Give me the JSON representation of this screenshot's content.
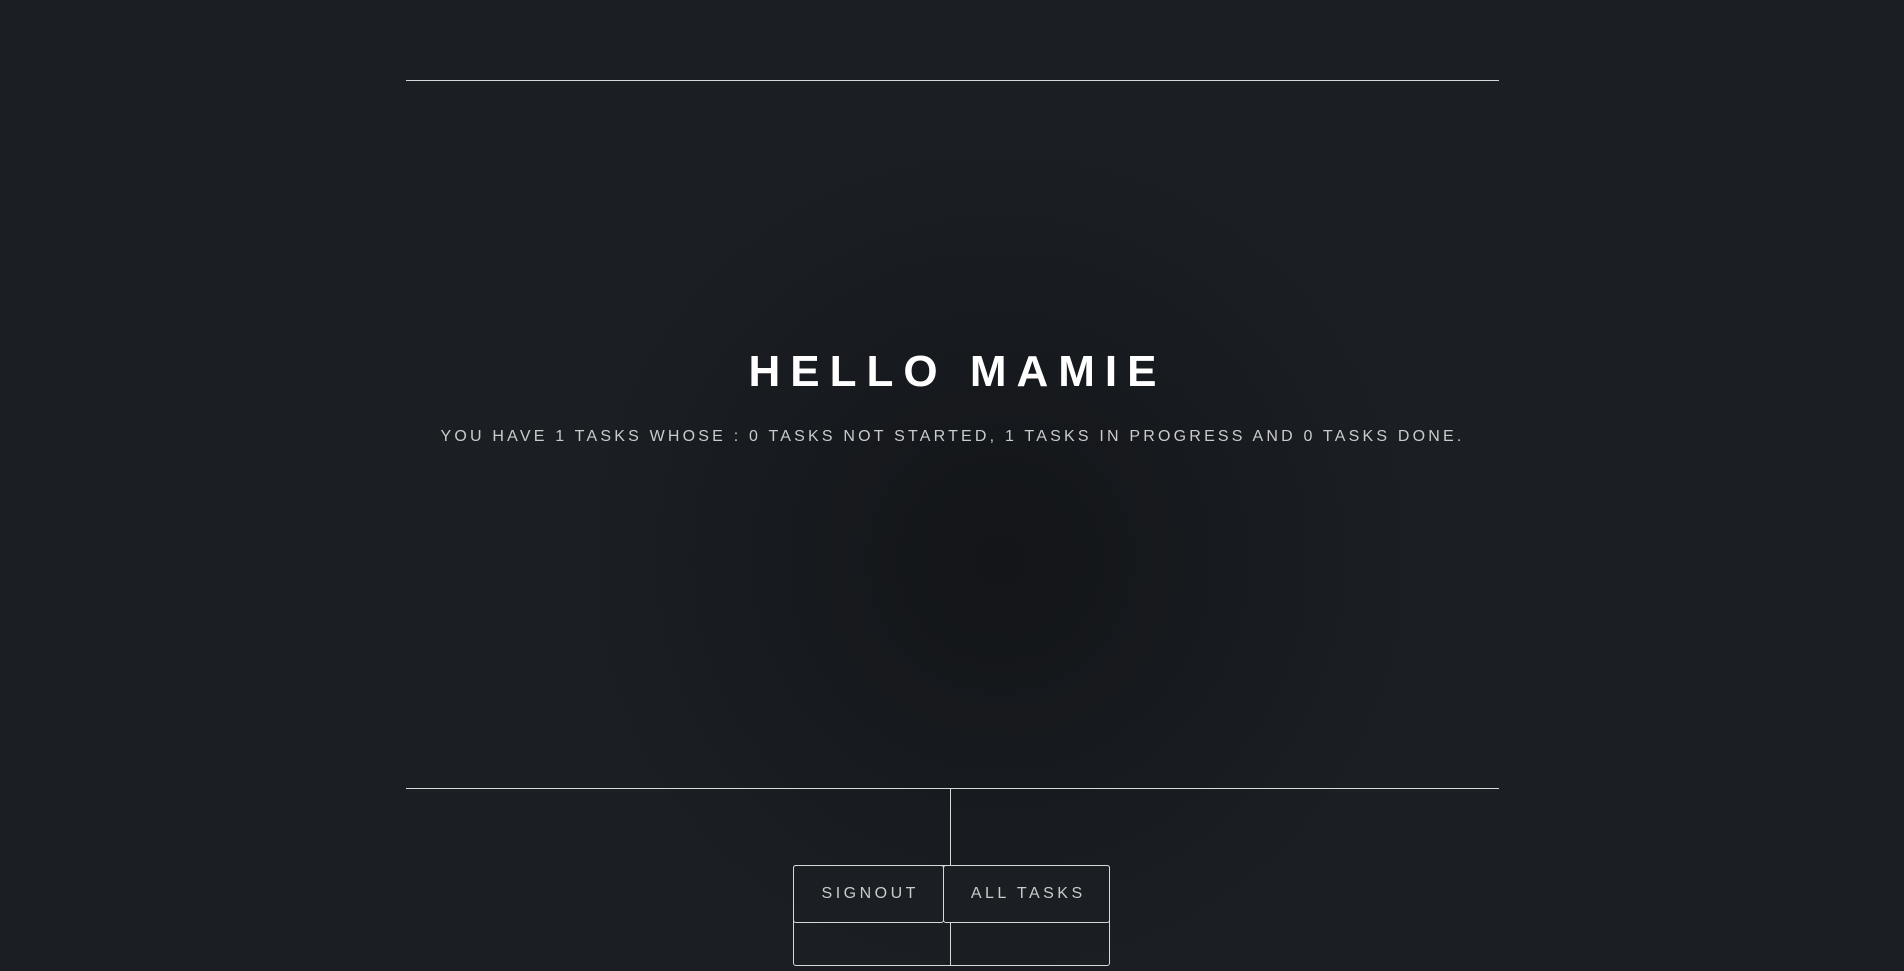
{
  "header": {
    "greeting": "HELLO MAMIE",
    "summary": "YOU HAVE 1 TASKS WHOSE : 0 TASKS NOT STARTED, 1 TASKS IN PROGRESS AND 0 TASKS DONE."
  },
  "nav": {
    "signout_label": "SIGNOUT",
    "all_tasks_label": "ALL TASKS"
  },
  "colors": {
    "background": "#1b1f23",
    "line": "#d6d8da",
    "text_primary": "#ffffff",
    "text_secondary": "#c9cbcd"
  }
}
